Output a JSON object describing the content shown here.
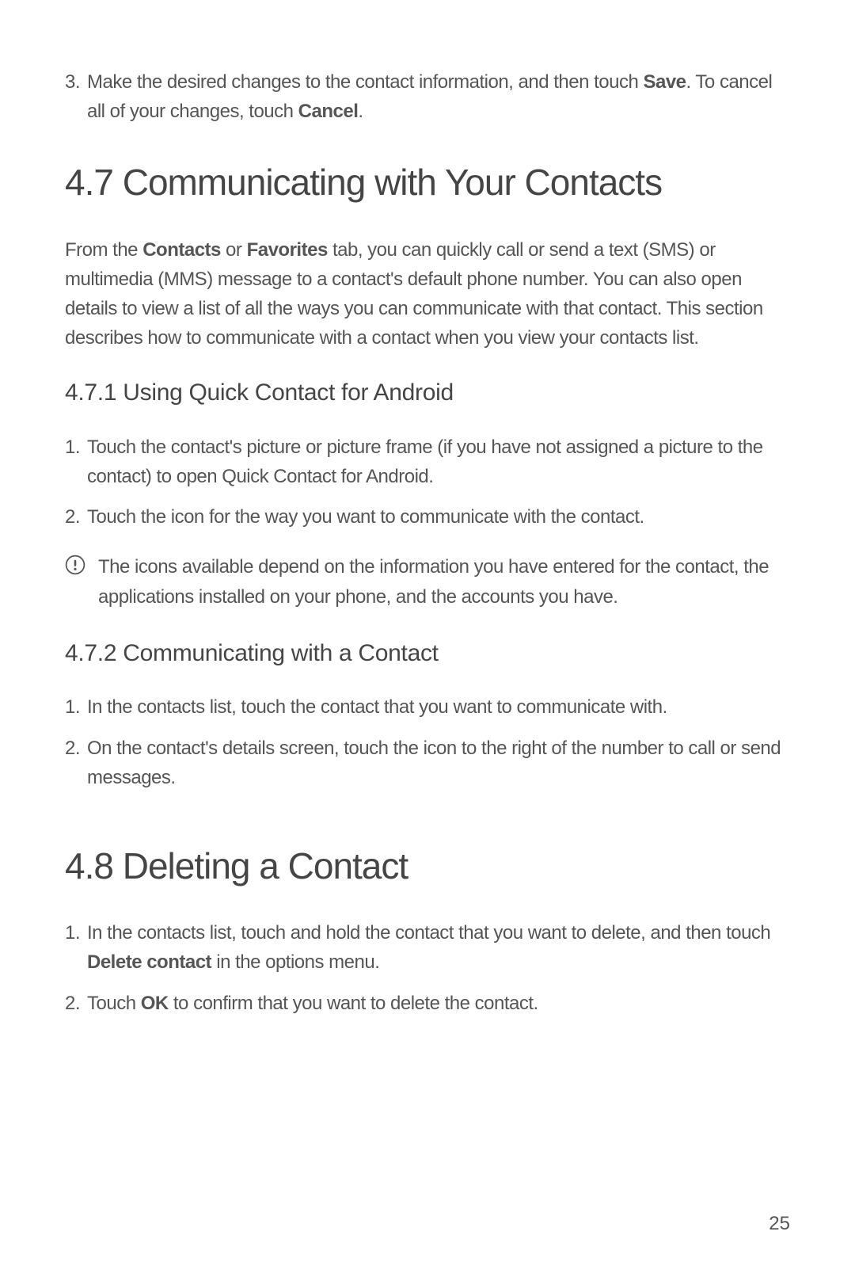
{
  "intro_item": {
    "num": "3.",
    "t1": "Make the desired changes to the contact information, and then touch ",
    "b1": "Save",
    "t2": ". To cancel all of your changes, touch ",
    "b2": "Cancel",
    "t3": "."
  },
  "s47": {
    "heading": "4.7  Communicating with Your Contacts",
    "para_t1": "From the ",
    "para_b1": "Contacts",
    "para_t2": " or ",
    "para_b2": "Favorites",
    "para_t3": " tab, you can quickly call or send a text (SMS) or multimedia (MMS) message to a contact's default phone number. You can also open details to view a list of all the ways you can communicate with that contact. This section describes how to communicate with a contact when you view your contacts list."
  },
  "s471": {
    "heading": "4.7.1  Using Quick Contact for Android",
    "item1_num": "1.",
    "item1_text": "Touch the contact's picture or picture frame (if you have not assigned a picture to the contact) to open Quick Contact for Android.",
    "item2_num": "2.",
    "item2_text": "Touch the icon for the way you want to communicate with the contact.",
    "note": "The icons available depend on the information you have entered for the contact, the applications installed on your phone, and the accounts you have."
  },
  "s472": {
    "heading": "4.7.2  Communicating with a Contact",
    "item1_num": "1.",
    "item1_text": "In the contacts list, touch the contact that you want to communicate with.",
    "item2_num": "2.",
    "item2_text": "On the contact's details screen, touch the icon to the right of the number to call or send messages."
  },
  "s48": {
    "heading": "4.8  Deleting a Contact",
    "item1_num": "1.",
    "item1_t1": "In the contacts list, touch and hold the contact that you want to delete, and then touch ",
    "item1_b1": "Delete contact",
    "item1_t2": " in the options menu.",
    "item2_num": "2.",
    "item2_t1": "Touch ",
    "item2_b1": "OK",
    "item2_t2": " to confirm that you want to delete the contact."
  },
  "page_num": "25"
}
